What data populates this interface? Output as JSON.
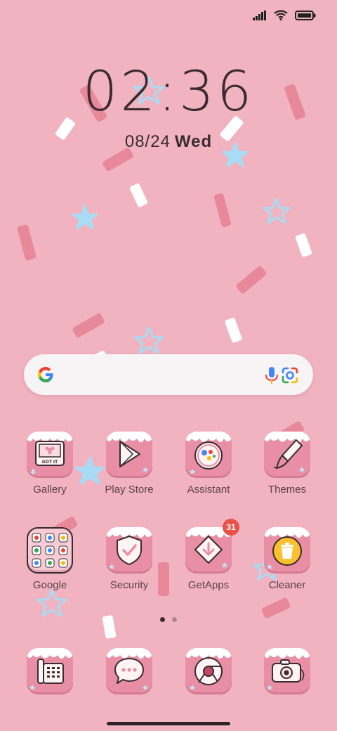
{
  "status_bar": {
    "icons": [
      "signal-icon",
      "wifi-icon",
      "battery-icon"
    ]
  },
  "clock": {
    "time": "02:36",
    "date": "08/24",
    "weekday": "Wed"
  },
  "search_bar": {
    "logo": "google-logo-icon",
    "icons": [
      "mic-icon",
      "lens-icon"
    ]
  },
  "apps": {
    "gallery": {
      "label": "Gallery",
      "icon": "gallery-icon",
      "tile_text": "GOT IT"
    },
    "play_store": {
      "label": "Play Store",
      "icon": "play-store-icon"
    },
    "assistant": {
      "label": "Assistant",
      "icon": "assistant-icon"
    },
    "themes": {
      "label": "Themes",
      "icon": "brush-icon"
    },
    "google": {
      "label": "Google",
      "icon": "folder-icon"
    },
    "security": {
      "label": "Security",
      "icon": "shield-icon"
    },
    "getapps": {
      "label": "GetApps",
      "icon": "getapps-icon",
      "badge": "31"
    },
    "cleaner": {
      "label": "Cleaner",
      "icon": "trash-icon"
    },
    "phone": {
      "icon": "phone-icon"
    },
    "messages": {
      "icon": "message-icon"
    },
    "chrome": {
      "icon": "chrome-icon"
    },
    "camera": {
      "icon": "camera-icon"
    }
  },
  "page_indicator": {
    "pages": 2,
    "current": 1
  },
  "colors": {
    "background": "#f1b3c0",
    "tile": "#e88fa5",
    "text_dark": "#3a2b31",
    "badge": "#e8524a",
    "google_blue": "#4285f4",
    "google_red": "#ea4335",
    "google_yellow": "#fbbc05",
    "google_green": "#34a853"
  }
}
